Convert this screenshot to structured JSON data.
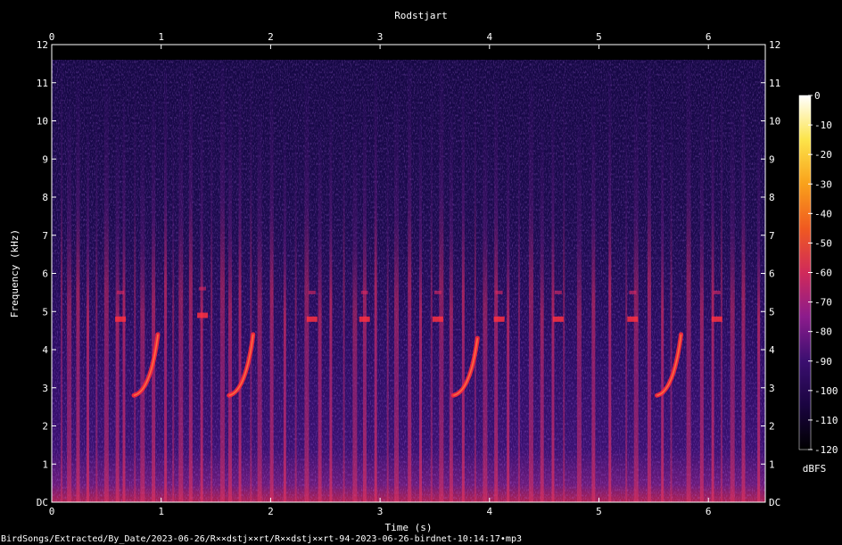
{
  "chart_data": {
    "type": "heatmap",
    "title": "Rodstjart",
    "xlabel": "Time (s)",
    "ylabel": "Frequency (kHz)",
    "xlim": [
      0,
      6.52
    ],
    "ylim": [
      0,
      12
    ],
    "x_ticks": [
      "0",
      "1",
      "2",
      "3",
      "4",
      "5",
      "6"
    ],
    "x_tick_values": [
      0,
      1,
      2,
      3,
      4,
      5,
      6
    ],
    "y_ticks": [
      "DC",
      "1",
      "2",
      "3",
      "4",
      "5",
      "6",
      "7",
      "8",
      "9",
      "10",
      "11",
      "12"
    ],
    "y_tick_values": [
      0,
      1,
      2,
      3,
      4,
      5,
      6,
      7,
      8,
      9,
      10,
      11,
      12
    ],
    "signal_max_khz": 11.6,
    "colorbar": {
      "label": "dBFS",
      "ticks": [
        "0",
        "-10",
        "-20",
        "-30",
        "-40",
        "-50",
        "-60",
        "-70",
        "-80",
        "-90",
        "-100",
        "-110",
        "-120"
      ],
      "tick_values": [
        0,
        -10,
        -20,
        -30,
        -40,
        -50,
        -60,
        -70,
        -80,
        -90,
        -100,
        -110,
        -120
      ],
      "range": [
        -120,
        0
      ],
      "colors": [
        "#000000",
        "#1a0440",
        "#3b0f70",
        "#8c1c8c",
        "#d02a5a",
        "#f05a20",
        "#f9a11b",
        "#fce44a",
        "#ffffff"
      ]
    },
    "transients_s": [
      0.09,
      0.16,
      0.24,
      0.33,
      0.41,
      0.5,
      0.6,
      0.66,
      0.76,
      0.83,
      0.93,
      1.04,
      1.11,
      1.18,
      1.27,
      1.37,
      1.46,
      1.56,
      1.63,
      1.72,
      1.82,
      1.9,
      2.01,
      2.13,
      2.23,
      2.33,
      2.45,
      2.55,
      2.67,
      2.77,
      2.86,
      2.96,
      3.07,
      3.15,
      3.27,
      3.37,
      3.47,
      3.56,
      3.65,
      3.76,
      3.87,
      3.96,
      4.06,
      4.17,
      4.27,
      4.38,
      4.48,
      4.58,
      4.68,
      4.82,
      4.95,
      5.1,
      5.25,
      5.34,
      5.46,
      5.58,
      5.66,
      5.82,
      5.94,
      6.04,
      6.12,
      6.22,
      6.32,
      6.46
    ],
    "calls": [
      {
        "t": 0.62,
        "kind": "pulse",
        "f_khz": 4.8
      },
      {
        "t": 0.75,
        "kind": "chirp",
        "f_start_khz": 2.8,
        "f_end_khz": 4.4
      },
      {
        "t": 1.37,
        "kind": "pulse",
        "f_khz": 4.9
      },
      {
        "t": 1.62,
        "kind": "chirp",
        "f_start_khz": 2.8,
        "f_end_khz": 4.4
      },
      {
        "t": 2.37,
        "kind": "pulse",
        "f_khz": 4.8
      },
      {
        "t": 2.85,
        "kind": "pulse",
        "f_khz": 4.8
      },
      {
        "t": 3.52,
        "kind": "pulse",
        "f_khz": 4.8
      },
      {
        "t": 3.67,
        "kind": "chirp",
        "f_start_khz": 2.8,
        "f_end_khz": 4.3
      },
      {
        "t": 4.08,
        "kind": "pulse",
        "f_khz": 4.8
      },
      {
        "t": 4.62,
        "kind": "pulse",
        "f_khz": 4.8
      },
      {
        "t": 5.3,
        "kind": "pulse",
        "f_khz": 4.8
      },
      {
        "t": 5.53,
        "kind": "chirp",
        "f_start_khz": 2.8,
        "f_end_khz": 4.4
      },
      {
        "t": 6.07,
        "kind": "pulse",
        "f_khz": 4.8
      }
    ]
  },
  "footer": {
    "path": "BirdSongs/Extracted/By_Date/2023-06-26/R××dstj××rt/R××dstj××rt-94-2023-06-26-birdnet-10:14:17•mp3"
  }
}
